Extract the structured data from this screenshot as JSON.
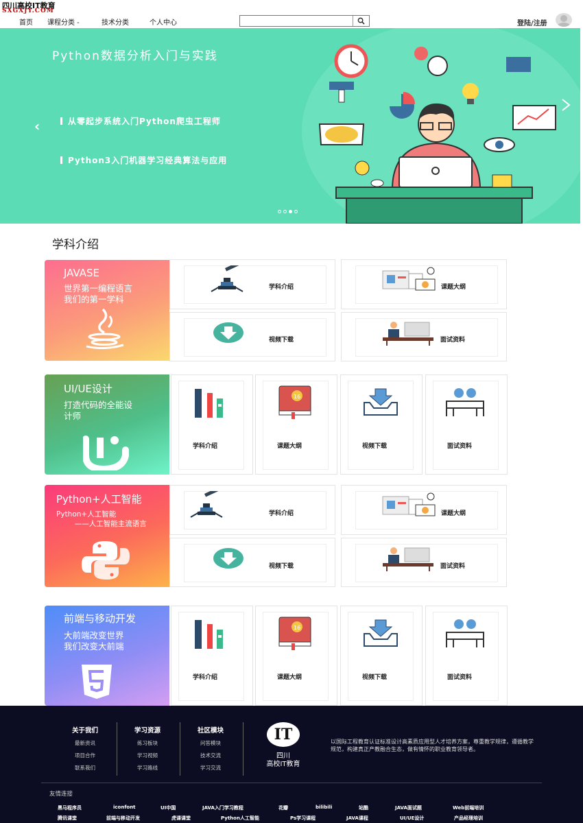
{
  "brand": {
    "name_cn": "四川高校IT教育",
    "name_en": "SXGXJY.COM"
  },
  "nav": [
    "首页",
    "课程分类 -",
    "技术分类",
    "个人中心"
  ],
  "header": {
    "login": "登陆/注册"
  },
  "banner": {
    "title": "Python数据分析入门与实践",
    "lines": [
      "从零起步系统入门Python爬虫工程师",
      "Python3入门机器学习经典算法与应用"
    ],
    "prev": "‹"
  },
  "section_title": "学科介绍",
  "subjects": [
    {
      "title": "JAVASE",
      "subtitle": "世界第一编程语言\n我们的第一学科",
      "cards": [
        "学科介绍",
        "课题大纲",
        "视频下载",
        "面试资料"
      ]
    },
    {
      "title": "UI/UE设计",
      "subtitle": "打造代码的全能设\n计师",
      "cards": [
        "学科介绍",
        "课题大纲",
        "视频下载",
        "面试资料"
      ]
    },
    {
      "title": "Python+人工智能",
      "subtitle": "Python+人工智能\n        ——人工智能主流语言",
      "cards": [
        "学科介绍",
        "课题大纲",
        "视频下载",
        "面试资料"
      ]
    },
    {
      "title": "前端与移动开发",
      "subtitle": "大前端改变世界\n我们改变大前端",
      "cards": [
        "学科介绍",
        "课题大纲",
        "视频下载",
        "面试资料"
      ]
    }
  ],
  "footer": {
    "cols": [
      {
        "head": "关于我们",
        "items": [
          "最新资讯",
          "项目合作",
          "联系我们"
        ]
      },
      {
        "head": "学习资源",
        "items": [
          "练习板块",
          "学习视频",
          "学习路线"
        ]
      },
      {
        "head": "社区模块",
        "items": [
          "问答模块",
          "技术交流",
          "学习交流"
        ]
      }
    ],
    "logo_text": "IT",
    "logo_name": "四川\n高校IT教育",
    "desc": "以国际工程教育认证标准设计高素质应用型人才培养方案，尊重教学规律，遵循教学规范，构建真正产教融合生态，做有情怀的职业教育领导者。",
    "links_title": "友情连接",
    "links": [
      "黑马程序员",
      "iconfont",
      "UI中国",
      "JAVA入门学习教程",
      "花瓣",
      "bilibili",
      "站酷",
      "JAVA面试题",
      "Web前端培训",
      "腾讯课堂",
      "前端与移动开发",
      "虎课课堂",
      "Python人工智能",
      "Ps学习课程",
      "JAVA课程",
      "UI/UE设计",
      "产品经理培训"
    ]
  }
}
